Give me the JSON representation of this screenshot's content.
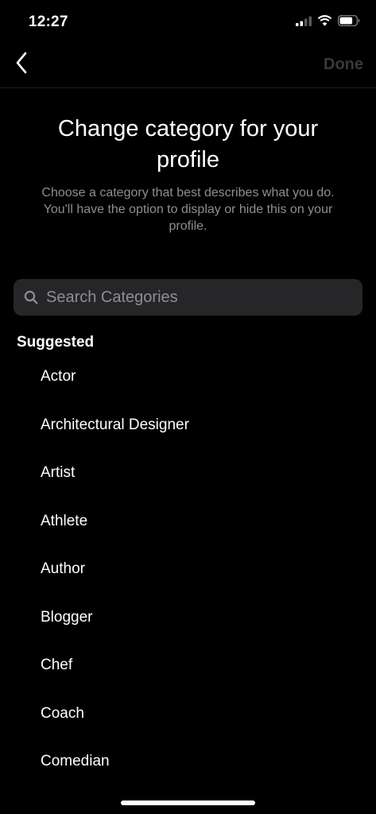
{
  "status_bar": {
    "time": "12:27",
    "icons": [
      "cellular-signal-icon",
      "wifi-icon",
      "battery-icon"
    ]
  },
  "nav": {
    "back_icon": "chevron-left-icon",
    "done_label": "Done"
  },
  "header": {
    "title": "Change category for your profile",
    "subtitle": "Choose a category that best describes what you do. You'll have the option to display or hide this on your profile."
  },
  "search": {
    "icon": "search-icon",
    "placeholder": "Search Categories",
    "value": ""
  },
  "suggested": {
    "label": "Suggested",
    "items": [
      {
        "label": "Actor"
      },
      {
        "label": "Architectural Designer"
      },
      {
        "label": "Artist"
      },
      {
        "label": "Athlete"
      },
      {
        "label": "Author"
      },
      {
        "label": "Blogger"
      },
      {
        "label": "Chef"
      },
      {
        "label": "Coach"
      },
      {
        "label": "Comedian"
      }
    ]
  },
  "colors": {
    "background": "#000000",
    "text_primary": "#ffffff",
    "text_secondary": "#8e8e93",
    "search_background": "#262628",
    "done_disabled": "#3a3a3c"
  }
}
